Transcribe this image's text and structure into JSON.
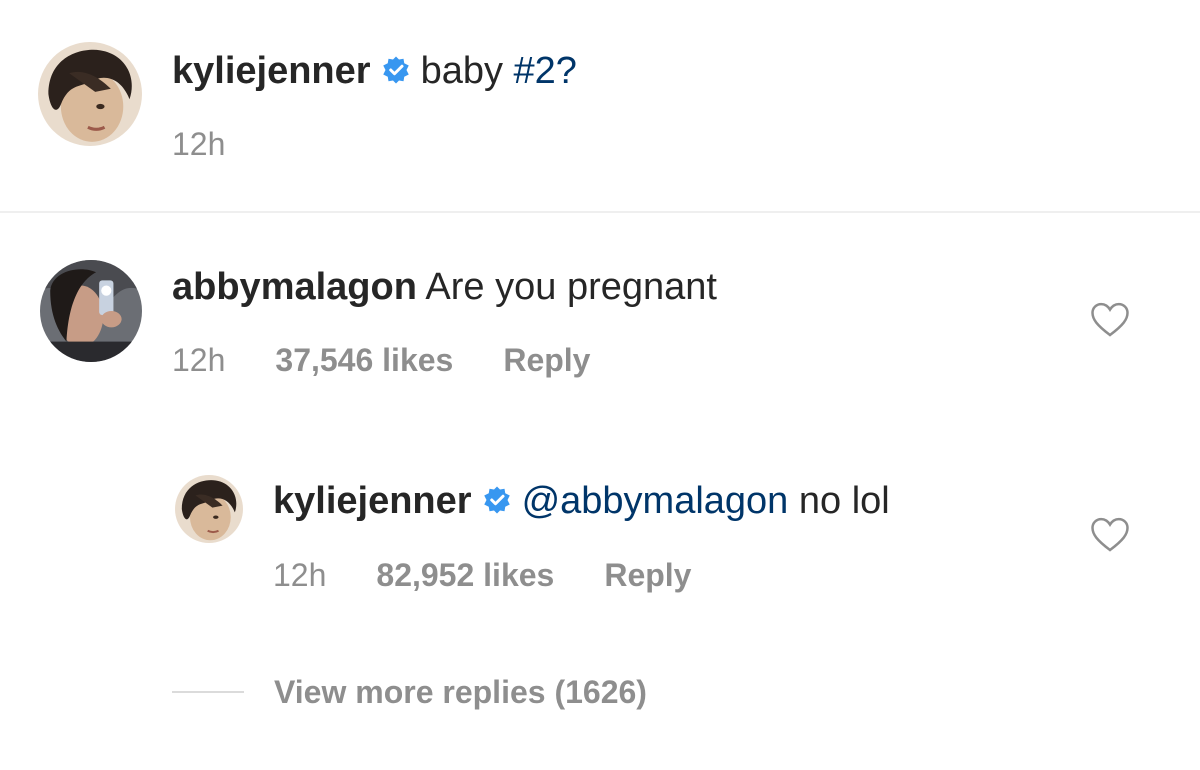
{
  "caption": {
    "username": "kyliejenner",
    "text": "baby",
    "hashtag": "#2?",
    "time": "12h"
  },
  "comment": {
    "username": "abbymalagon",
    "text": "Are you pregnant",
    "time": "12h",
    "likes": "37,546 likes",
    "reply_label": "Reply"
  },
  "reply": {
    "username": "kyliejenner",
    "mention": "@abbymalagon",
    "text": "no lol",
    "time": "12h",
    "likes": "82,952 likes",
    "reply_label": "Reply"
  },
  "view_more": "View more replies (1626)",
  "colors": {
    "verified_badge": "#3897f0",
    "link": "#003569",
    "meta_text": "#8e8e8e",
    "divider": "#efefef"
  },
  "icons": {
    "verified": "verified-badge-icon",
    "like": "heart-outline-icon"
  }
}
